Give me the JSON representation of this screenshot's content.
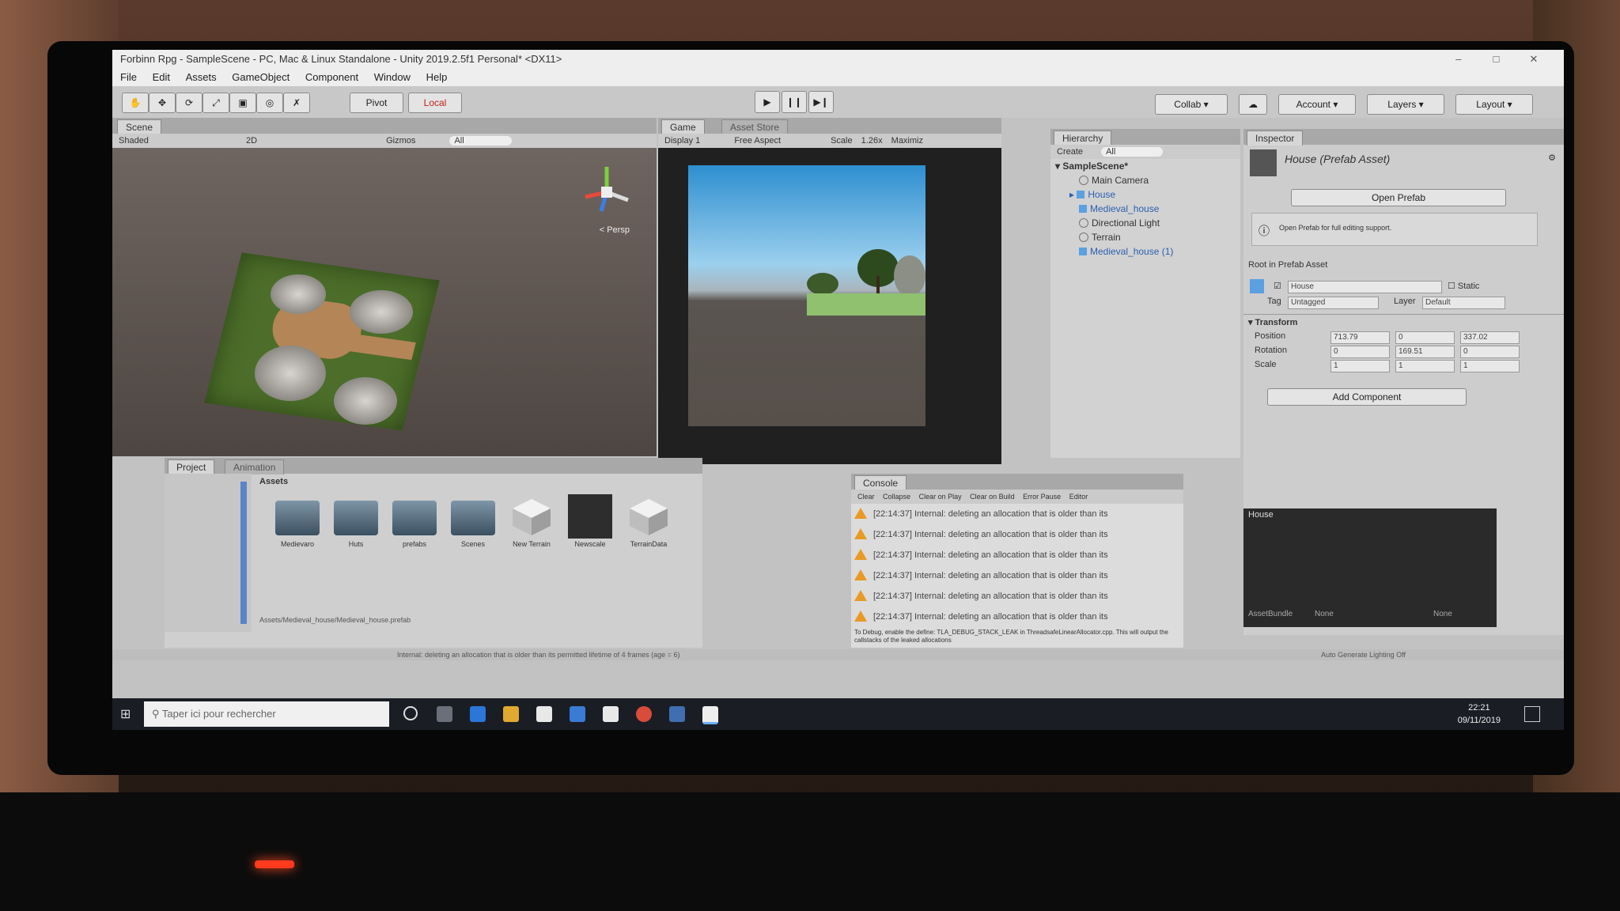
{
  "window": {
    "title": "Forbinn Rpg - SampleScene - PC, Mac & Linux Standalone - Unity 2019.2.5f1 Personal* <DX11>"
  },
  "menu": [
    "File",
    "Edit",
    "Assets",
    "GameObject",
    "Component",
    "Window",
    "Help"
  ],
  "toolbar": {
    "pivot": "Pivot",
    "local": "Local",
    "collab": "Collab",
    "account": "Account",
    "layers": "Layers",
    "layout": "Layout"
  },
  "scene": {
    "tab": "Scene",
    "shading": "Shaded",
    "mode": "2D",
    "gizmos": "Gizmos",
    "search_placeholder": "All",
    "persp": "< Persp"
  },
  "game": {
    "tab": "Game",
    "asset_store_tab": "Asset Store",
    "display": "Display 1",
    "aspect": "Free Aspect",
    "scale_label": "Scale",
    "scale_value": "1.26x",
    "maximize": "Maximiz"
  },
  "hierarchy": {
    "tab": "Hierarchy",
    "create": "Create",
    "search_placeholder": "All",
    "scene": "SampleScene*",
    "items": [
      "Main Camera",
      "House",
      "Medieval_house",
      "Directional Light",
      "Terrain",
      "Medieval_house (1)"
    ]
  },
  "inspector": {
    "tab": "Inspector",
    "asset_title": "House (Prefab Asset)",
    "open_prefab": "Open Prefab",
    "info": "Open Prefab for full editing support.",
    "root_label": "Root in Prefab Asset",
    "name": "House",
    "static": "Static",
    "tag_label": "Tag",
    "tag_value": "Untagged",
    "layer_label": "Layer",
    "layer_value": "Default",
    "transform": "Transform",
    "position_label": "Position",
    "rotation_label": "Rotation",
    "scale_label": "Scale",
    "position": [
      "713.79",
      "0",
      "337.02"
    ],
    "rotation": [
      "0",
      "169.51",
      "0"
    ],
    "scale": [
      "1",
      "1",
      "1"
    ],
    "add_component": "Add Component",
    "preview_title": "House",
    "asset_bundle": "AssetBundle",
    "asset_bundle_value": "None",
    "asset_bundle_variant": "None"
  },
  "project": {
    "tab": "Project",
    "tab2": "Animation",
    "path_label": "Assets",
    "assets": [
      "Medievaro",
      "Huts",
      "prefabs",
      "Scenes",
      "New Terrain",
      "Newscale",
      "TerrainData"
    ],
    "bottom_path": "Assets/Medieval_house/Medieval_house.prefab"
  },
  "console": {
    "tab": "Console",
    "buttons": [
      "Clear",
      "Collapse",
      "Clear on Play",
      "Clear on Build",
      "Error Pause",
      "Editor"
    ],
    "messages": [
      "[22:14:37] Internal: deleting an allocation that is older than its",
      "[22:14:37] Internal: deleting an allocation that is older than its",
      "[22:14:37] Internal: deleting an allocation that is older than its",
      "[22:14:37] Internal: deleting an allocation that is older than its",
      "[22:14:37] Internal: deleting an allocation that is older than its",
      "[22:14:37] Internal: deleting an allocation that is older than its"
    ],
    "footer": "To Debug, enable the define: TLA_DEBUG_STACK_LEAK in ThreadsafeLinearAllocator.cpp. This will output the callstacks of the leaked allocations"
  },
  "status": {
    "message": "Internal: deleting an allocation that is older than its permitted lifetime of 4 frames (age = 6)",
    "bake": "Auto Generate Lighting Off"
  },
  "taskbar": {
    "search_placeholder": "Taper ici pour rechercher",
    "time": "22:21",
    "date": "09/11/2019"
  },
  "colors": {
    "accent": "#2a5fb0",
    "warning": "#e89a23",
    "play_bg": "#e4e4e4"
  }
}
